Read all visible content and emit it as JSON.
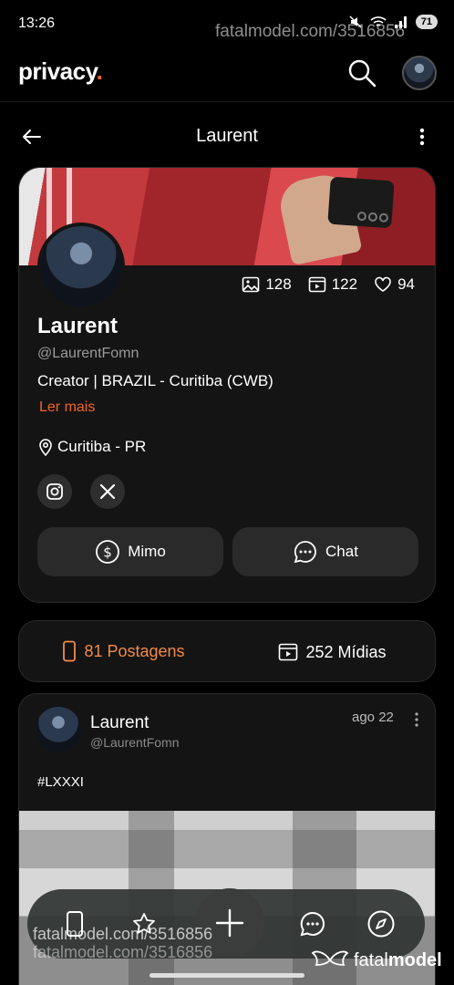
{
  "status_bar": {
    "time": "13:26",
    "battery": "71"
  },
  "watermark": {
    "top": "fatalmodel.com/3516856",
    "bottom": "fatalmodel.com/3516856",
    "logo_prefix": "fatal",
    "logo_suffix": "model"
  },
  "app": {
    "logo": "privacy",
    "logo_dot": "."
  },
  "header": {
    "title": "Laurent"
  },
  "profile": {
    "name": "Laurent",
    "handle": "@LaurentFomn",
    "bio": "Creator | BRAZIL - Curitiba (CWB)",
    "read_more": "Ler mais",
    "location": "Curitiba - PR",
    "stats": {
      "photos": "128",
      "videos": "122",
      "likes": "94"
    },
    "buttons": {
      "mimo": "Mimo",
      "chat": "Chat"
    },
    "socials": [
      "instagram-icon",
      "x-icon"
    ]
  },
  "tabs": [
    {
      "label": "81 Postagens",
      "active": true
    },
    {
      "label": "252 Mídias",
      "active": false
    }
  ],
  "post": {
    "author": "Laurent",
    "handle": "@LaurentFomn",
    "date": "ago 22",
    "text": "#LXXXI"
  },
  "bottom_nav": [
    "phone-icon",
    "star-icon",
    "plus-icon",
    "chat-icon",
    "compass-icon"
  ],
  "colors": {
    "accent": "#f26522",
    "background": "#000000",
    "card": "#141414"
  }
}
